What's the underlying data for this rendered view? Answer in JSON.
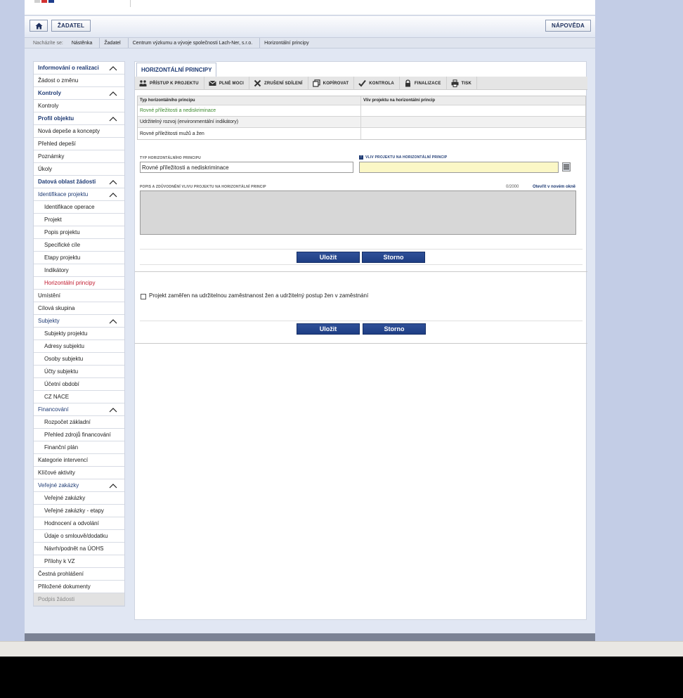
{
  "header": {
    "home_label": "",
    "zadatel_label": "ŽADATEL",
    "help_label": "NÁPOVĚDA",
    "flag_colors": [
      "#cfcfcf",
      "#d23131",
      "#1e3d8c"
    ]
  },
  "breadcrumb": {
    "label": "Nacházíte se:",
    "items": [
      "Nástěnka",
      "Žadatel",
      "Centrum výzkumu a vývoje společnosti Lach-Ner, s.r.o.",
      "Horizontální principy"
    ]
  },
  "sidebar": {
    "items": [
      {
        "label": "Informování o realizaci",
        "level": 0,
        "type": "sect",
        "chevron": true
      },
      {
        "label": "Žádost o změnu",
        "level": 0,
        "type": "item"
      },
      {
        "label": "Kontroly",
        "level": 0,
        "type": "sect",
        "chevron": true
      },
      {
        "label": "Kontroly",
        "level": 0,
        "type": "item"
      },
      {
        "label": "Profil objektu",
        "level": 0,
        "type": "sect",
        "chevron": true
      },
      {
        "label": "Nová depeše a koncepty",
        "level": 0,
        "type": "item"
      },
      {
        "label": "Přehled depeší",
        "level": 0,
        "type": "item"
      },
      {
        "label": "Poznámky",
        "level": 0,
        "type": "item"
      },
      {
        "label": "Úkoly",
        "level": 0,
        "type": "item"
      },
      {
        "label": "Datová oblast žádosti",
        "level": 0,
        "type": "sect",
        "chevron": true
      },
      {
        "label": "Identifikace projektu",
        "level": 0,
        "type": "sub",
        "chevron": true
      },
      {
        "label": "Identifikace operace",
        "level": 1,
        "type": "item"
      },
      {
        "label": "Projekt",
        "level": 1,
        "type": "item"
      },
      {
        "label": "Popis projektu",
        "level": 1,
        "type": "item"
      },
      {
        "label": "Specifické cíle",
        "level": 1,
        "type": "item"
      },
      {
        "label": "Etapy projektu",
        "level": 1,
        "type": "item"
      },
      {
        "label": "Indikátory",
        "level": 1,
        "type": "item"
      },
      {
        "label": "Horizontální principy",
        "level": 1,
        "type": "active"
      },
      {
        "label": "Umístění",
        "level": 0,
        "type": "item"
      },
      {
        "label": "Cílová skupina",
        "level": 0,
        "type": "item"
      },
      {
        "label": "Subjekty",
        "level": 0,
        "type": "sub",
        "chevron": true
      },
      {
        "label": "Subjekty projektu",
        "level": 1,
        "type": "item"
      },
      {
        "label": "Adresy subjektu",
        "level": 1,
        "type": "item"
      },
      {
        "label": "Osoby subjektu",
        "level": 1,
        "type": "item"
      },
      {
        "label": "Účty subjektu",
        "level": 1,
        "type": "item"
      },
      {
        "label": "Účetní období",
        "level": 1,
        "type": "item"
      },
      {
        "label": "CZ NACE",
        "level": 1,
        "type": "item"
      },
      {
        "label": "Financování",
        "level": 0,
        "type": "sub",
        "chevron": true
      },
      {
        "label": "Rozpočet základní",
        "level": 1,
        "type": "item"
      },
      {
        "label": "Přehled zdrojů financování",
        "level": 1,
        "type": "item"
      },
      {
        "label": "Finanční plán",
        "level": 1,
        "type": "item"
      },
      {
        "label": "Kategorie intervencí",
        "level": 0,
        "type": "item"
      },
      {
        "label": "Klíčové aktivity",
        "level": 0,
        "type": "item"
      },
      {
        "label": "Veřejné zakázky",
        "level": 0,
        "type": "sub",
        "chevron": true
      },
      {
        "label": "Veřejné zakázky",
        "level": 1,
        "type": "item"
      },
      {
        "label": "Veřejné zakázky - etapy",
        "level": 1,
        "type": "item"
      },
      {
        "label": "Hodnocení a odvolání",
        "level": 1,
        "type": "item"
      },
      {
        "label": "Údaje o smlouvě/dodatku",
        "level": 1,
        "type": "item"
      },
      {
        "label": "Návrh/podnět na ÚOHS",
        "level": 1,
        "type": "item"
      },
      {
        "label": "Přílohy k VZ",
        "level": 1,
        "type": "item"
      },
      {
        "label": "Čestná prohlášení",
        "level": 0,
        "type": "item"
      },
      {
        "label": "Přiložené dokumenty",
        "level": 0,
        "type": "item"
      },
      {
        "label": "Podpis žádosti",
        "level": 0,
        "type": "disabled"
      }
    ]
  },
  "main": {
    "tab_title": "HORIZONTÁLNÍ PRINCIPY",
    "actions": [
      {
        "label": "PŘÍSTUP K PROJEKTU",
        "icon": "people-icon"
      },
      {
        "label": "PLNÉ MOCI",
        "icon": "envelope-icon"
      },
      {
        "label": "ZRUŠENÍ SDÍLENÍ",
        "icon": "x-icon"
      },
      {
        "label": "KOPÍROVAT",
        "icon": "copy-icon"
      },
      {
        "label": "KONTROLA",
        "icon": "check-icon"
      },
      {
        "label": "FINALIZACE",
        "icon": "lock-icon"
      },
      {
        "label": "TISK",
        "icon": "printer-icon"
      }
    ],
    "grid": {
      "headers": [
        "Typ horizontálního principu",
        "Vliv projektu na horizontální princip"
      ],
      "rows": [
        {
          "typ": "Rovné příležitosti a nediskriminace",
          "vliv": ""
        },
        {
          "typ": "Udržitelný rozvoj (environmentální indikátory)",
          "vliv": ""
        },
        {
          "typ": "Rovné příležitosti mužů a žen",
          "vliv": ""
        }
      ]
    },
    "form": {
      "typ_label": "TYP HORIZONTÁLNÍHO PRINCIPU",
      "typ_value": "Rovné příležitosti a nediskriminace",
      "vliv_label": "VLIV PROJEKTU NA HORIZONTÁLNÍ PRINCIP",
      "vliv_value": "",
      "popis_label": "POPIS A ZDŮVODNĚNÍ VLIVU PROJEKTU NA HORIZONTÁLNÍ PRINCIP",
      "counter": "0/2000",
      "open_new": "Otevřít v novém okně",
      "popis_value": "",
      "save": "Uložit",
      "cancel": "Storno"
    },
    "section2": {
      "checkbox_label": "Projekt zaměřen na udržitelnou zaměstnanost žen a udržitelný postup žen v zaměstnání",
      "checked": false,
      "save": "Uložit",
      "cancel": "Storno"
    }
  }
}
